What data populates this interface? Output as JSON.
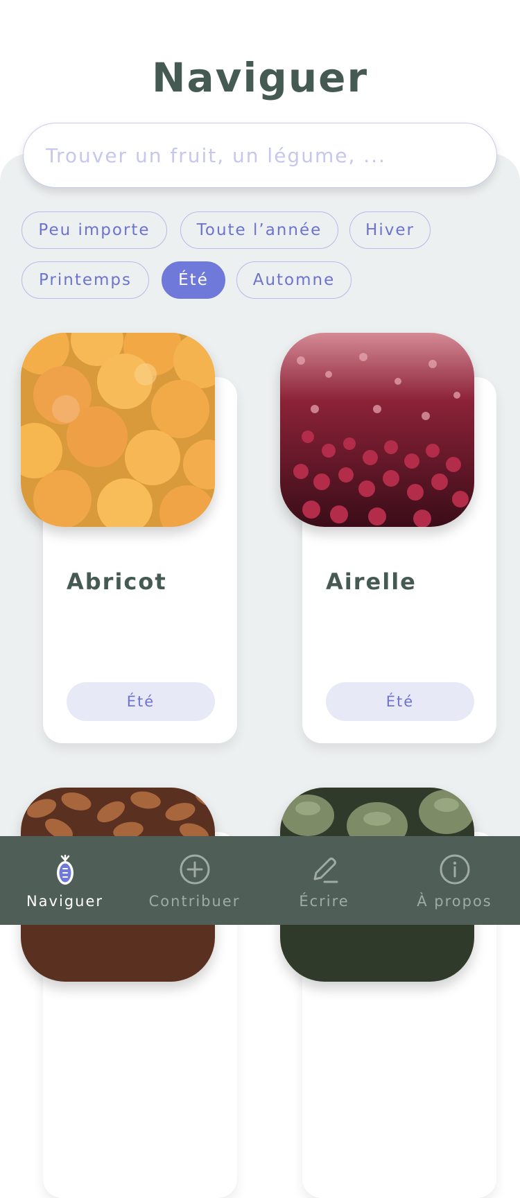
{
  "header": {
    "title": "Naviguer"
  },
  "search": {
    "placeholder": "Trouver un fruit, un légume, ..."
  },
  "filters": {
    "chips": [
      "Peu importe",
      "Toute l’année",
      "Hiver",
      "Printemps",
      "Été",
      "Automne"
    ],
    "selected": "Été"
  },
  "cards": [
    {
      "name": "Abricot",
      "season": "Été"
    },
    {
      "name": "Airelle",
      "season": "Été"
    }
  ],
  "nav": {
    "items": [
      "Naviguer",
      "Contribuer",
      "Écrire",
      "À propos"
    ],
    "active": "Naviguer"
  },
  "colors": {
    "title": "#465a54",
    "accent": "#6f79d9",
    "navbar": "#4f5f57",
    "background": "#edf0f0"
  }
}
